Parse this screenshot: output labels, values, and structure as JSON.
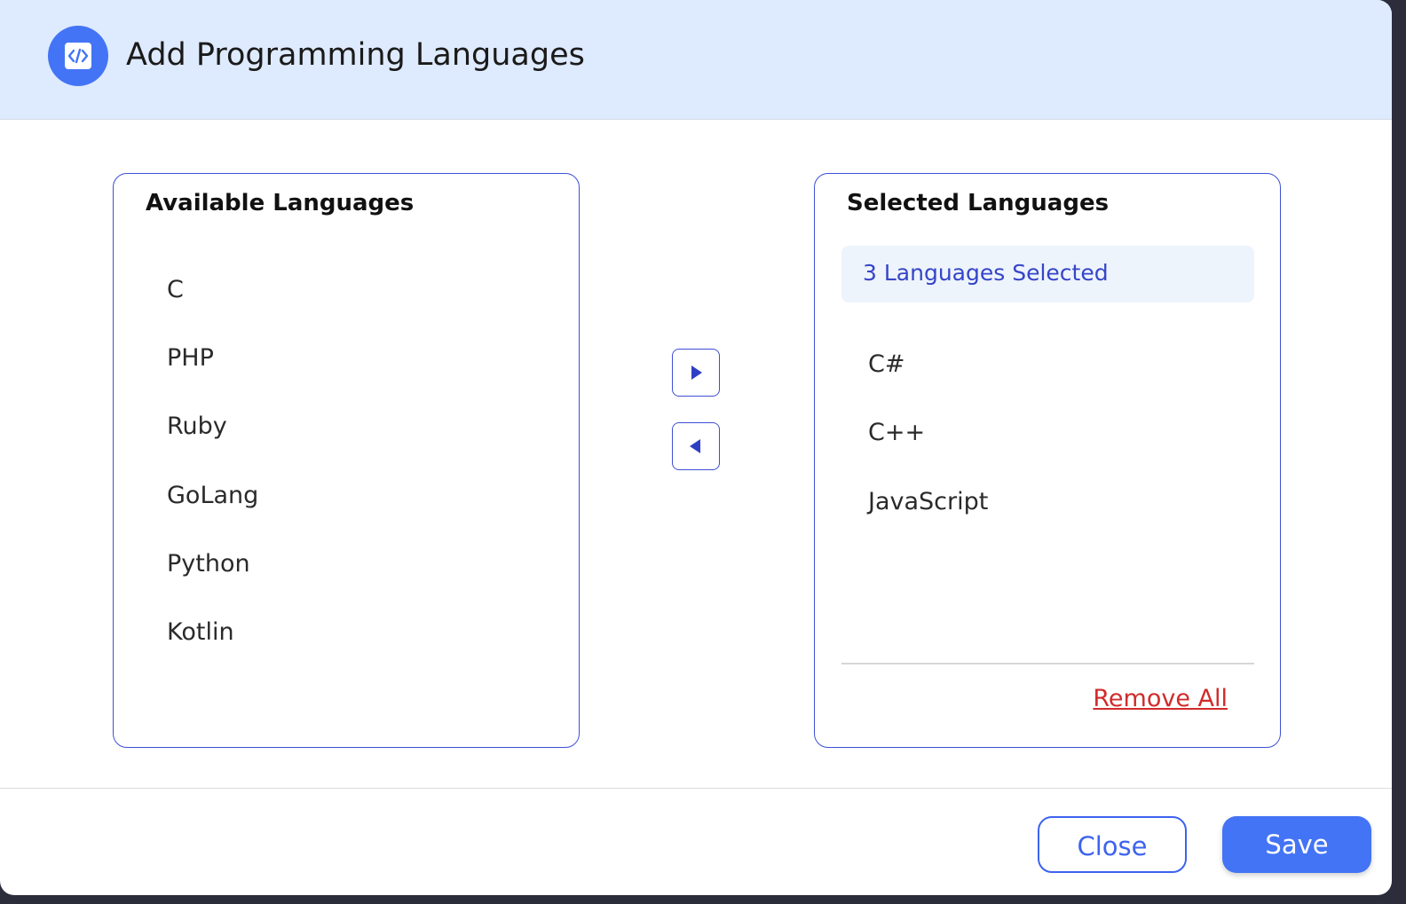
{
  "header": {
    "title": "Add Programming Languages",
    "icon": "code-icon"
  },
  "available": {
    "title": "Available Languages",
    "items": [
      "C",
      "PHP",
      "Ruby",
      "GoLang",
      "Python",
      "Kotlin"
    ]
  },
  "selected": {
    "title": "Selected Languages",
    "count_label": "3 Languages Selected",
    "items": [
      "C#",
      "C++",
      "JavaScript"
    ],
    "remove_all_label": "Remove All"
  },
  "transfer": {
    "move_right_icon": "triangle-right-icon",
    "move_left_icon": "triangle-left-icon"
  },
  "footer": {
    "close_label": "Close",
    "save_label": "Save"
  },
  "colors": {
    "header_bg": "#deeafd",
    "accent": "#4374f5",
    "panel_border": "#3d4fd6",
    "count_text": "#3545c8",
    "danger": "#d12b2b"
  }
}
